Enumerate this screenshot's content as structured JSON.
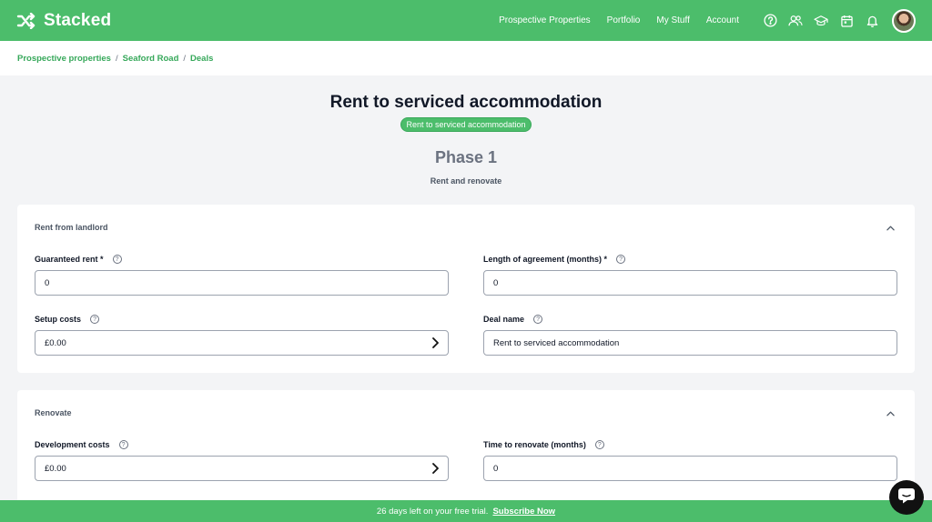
{
  "app": {
    "name": "Stacked"
  },
  "nav": {
    "links": [
      "Prospective Properties",
      "Portfolio",
      "My Stuff",
      "Account"
    ],
    "icons": [
      "help-circle-icon",
      "users-icon",
      "graduation-cap-icon",
      "calendar-icon",
      "bell-icon"
    ]
  },
  "breadcrumb": [
    "Prospective properties",
    "Seaford Road",
    "Deals"
  ],
  "header": {
    "title": "Rent to serviced accommodation",
    "badge": "Rent to serviced accommodation",
    "phase": "Phase 1",
    "phase_subtitle": "Rent and renovate"
  },
  "sections": [
    {
      "title": "Rent from landlord",
      "fields": [
        {
          "label": "Guaranteed rent *",
          "value": "0"
        },
        {
          "label": "Length of agreement (months) *",
          "value": "0"
        },
        {
          "label": "Setup costs",
          "value": "£0.00"
        },
        {
          "label": "Deal name",
          "value": "Rent to serviced accommodation"
        }
      ]
    },
    {
      "title": "Renovate",
      "fields": [
        {
          "label": "Development costs",
          "value": "£0.00"
        },
        {
          "label": "Time to renovate (months)",
          "value": "0"
        }
      ]
    }
  ],
  "help_glyph": "?",
  "banner": {
    "text": "26 days left on your free trial.",
    "link": "Subscribe Now"
  },
  "colors": {
    "brand_green": "#4cbd6b",
    "link_green": "#36a85a",
    "background": "#f3f4f6"
  }
}
